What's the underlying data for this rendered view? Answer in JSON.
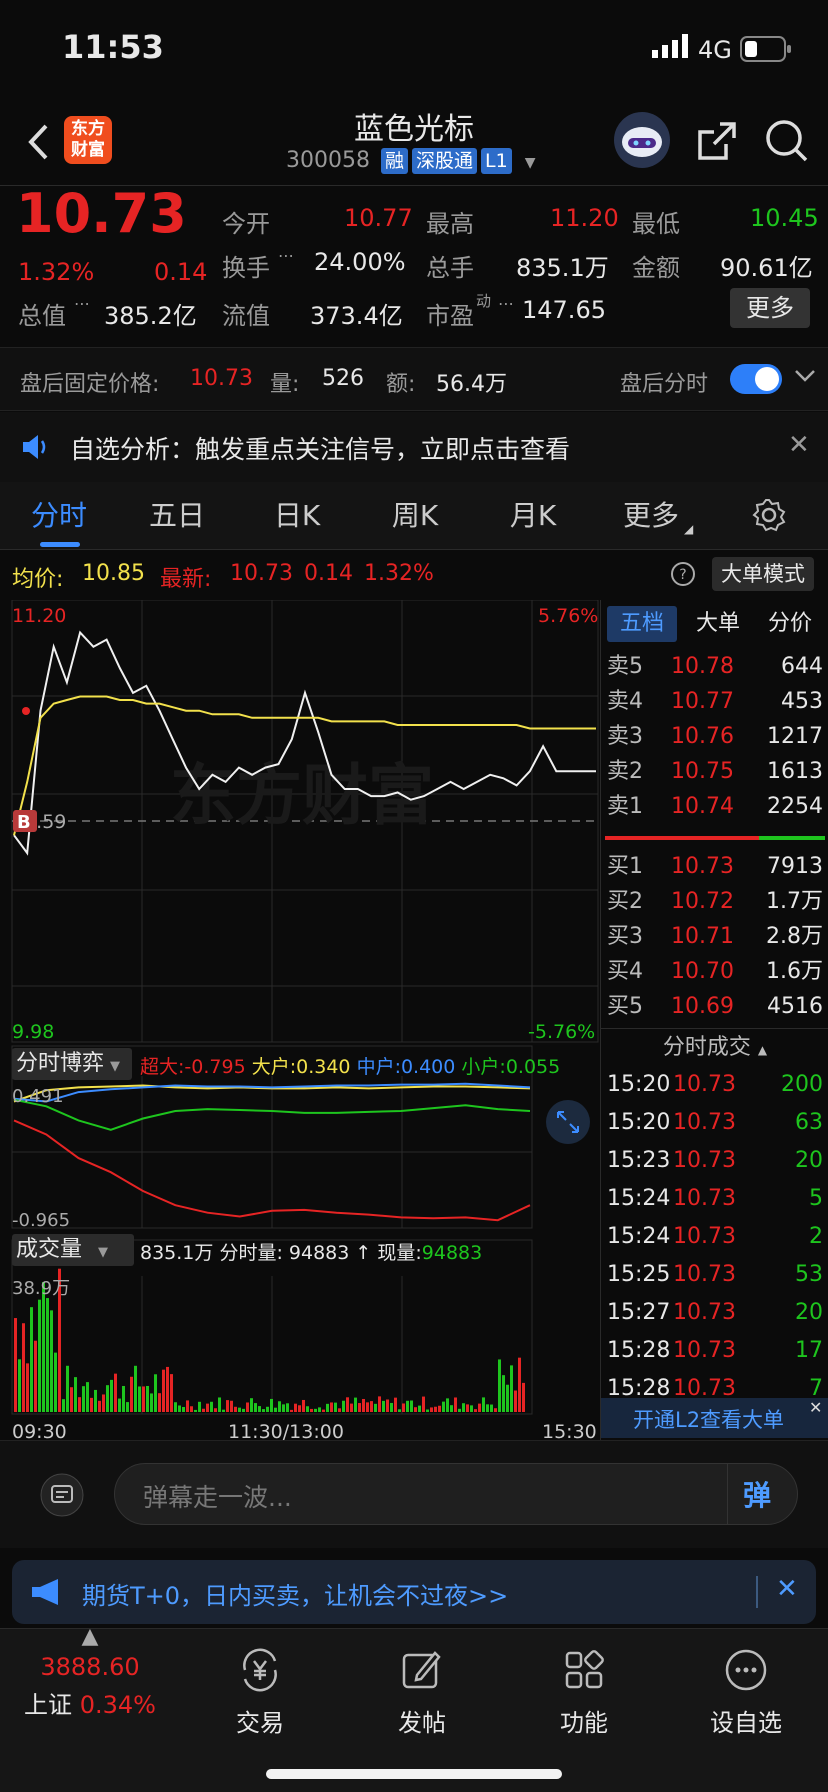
{
  "status_bar": {
    "time": "11:53",
    "network": "4G"
  },
  "header": {
    "app_logo_text": "东方财富",
    "title": "蓝色光标",
    "code": "300058",
    "badges": [
      "融",
      "深股通",
      "L1"
    ]
  },
  "quote": {
    "price": "10.73",
    "change_pct": "1.32%",
    "change": "0.14",
    "open_label": "今开",
    "open": "10.77",
    "high_label": "最高",
    "high": "11.20",
    "low_label": "最低",
    "low": "10.45",
    "turnover_label": "换手",
    "turnover": "24.00%",
    "volume_label": "总手",
    "volume": "835.1万",
    "amount_label": "金额",
    "amount": "90.61亿",
    "mcap_label": "总值",
    "mcap": "385.2亿",
    "float_label": "流值",
    "float_cap": "373.4亿",
    "pe_label": "市盈",
    "pe_sup": "动",
    "pe": "147.65",
    "more_button": "更多"
  },
  "after_hours": {
    "label": "盘后固定价格:",
    "price": "10.73",
    "qty_label": "量:",
    "qty": "526",
    "amt_label": "额:",
    "amt": "56.4万",
    "toggle_label": "盘后分时"
  },
  "notice": {
    "text": "自选分析：触发重点关注信号，立即点击查看"
  },
  "tabs": [
    "分时",
    "五日",
    "日K",
    "周K",
    "月K",
    "更多"
  ],
  "info_bar": {
    "avg_label": "均价:",
    "avg": "10.85",
    "latest_label": "最新:",
    "latest": "10.73",
    "latest_change": "0.14",
    "latest_pct": "1.32%",
    "mode_button": "大单模式"
  },
  "chart_labels": {
    "top_price": "11.20",
    "top_pct": "5.76%",
    "bottom_price": "9.98",
    "bottom_pct": "-5.76%",
    "mid_price": "10.59",
    "mark": "B",
    "watermark": "东方财富"
  },
  "chart_data": {
    "type": "line",
    "series": [
      {
        "values": [
          10.55,
          10.5,
          10.9,
          11.08,
          10.98,
          11.12,
          11.08,
          11.1,
          11.02,
          10.95,
          10.97,
          10.9,
          10.82,
          10.74,
          10.68,
          10.72,
          10.7,
          10.74,
          10.72,
          10.74,
          10.75,
          10.82,
          10.95,
          10.84,
          10.72,
          10.68,
          10.68,
          10.66,
          10.66,
          10.67,
          10.65,
          10.66,
          10.68,
          10.7,
          10.68,
          10.7,
          10.72,
          10.71,
          10.69,
          10.73,
          10.8,
          10.73,
          10.73,
          10.73,
          10.73
        ]
      },
      {
        "values": [
          10.55,
          10.7,
          10.88,
          10.92,
          10.93,
          10.94,
          10.94,
          10.94,
          10.93,
          10.93,
          10.92,
          10.92,
          10.91,
          10.9,
          10.9,
          10.89,
          10.89,
          10.89,
          10.88,
          10.88,
          10.88,
          10.88,
          10.88,
          10.88,
          10.87,
          10.87,
          10.87,
          10.87,
          10.87,
          10.86,
          10.86,
          10.86,
          10.86,
          10.86,
          10.86,
          10.86,
          10.86,
          10.86,
          10.86,
          10.85,
          10.85,
          10.85,
          10.85,
          10.85,
          10.85
        ]
      }
    ],
    "ylim": [
      9.98,
      11.2
    ],
    "x_ticks": [
      "09:30",
      "11:30/13:00",
      "15:30"
    ]
  },
  "game": {
    "selector": "分时博弈",
    "super_label": "超大:",
    "super": "-0.795",
    "big_label": "大户:",
    "big": "0.340",
    "mid_label": "中户:",
    "mid": "0.400",
    "small_label": "小户:",
    "small": "0.055",
    "top": "0.491",
    "bottom": "-0.965",
    "series": {
      "yellow": [
        0.3,
        0.42,
        0.45,
        0.46,
        0.47,
        0.45,
        0.44,
        0.45,
        0.44,
        0.44,
        0.45,
        0.44,
        0.45,
        0.46,
        0.46,
        0.45,
        0.44
      ],
      "blue": [
        0.33,
        0.3,
        0.4,
        0.43,
        0.45,
        0.47,
        0.46,
        0.46,
        0.45,
        0.46,
        0.47,
        0.47,
        0.48,
        0.48,
        0.49,
        0.47,
        0.45
      ],
      "green": [
        0.32,
        0.25,
        0.1,
        0.0,
        0.12,
        0.2,
        0.22,
        0.21,
        0.2,
        0.18,
        0.18,
        0.19,
        0.2,
        0.23,
        0.26,
        0.22,
        0.2
      ],
      "red": [
        0.1,
        -0.05,
        -0.3,
        -0.45,
        -0.65,
        -0.8,
        -0.88,
        -0.92,
        -0.86,
        -0.85,
        -0.88,
        -0.9,
        -0.93,
        -0.94,
        -0.93,
        -0.96,
        -0.8
      ]
    }
  },
  "volume": {
    "selector": "成交量",
    "total": "835.1万",
    "minute_label": "分时量:",
    "minute": "94883",
    "now_label": "现量:",
    "now": "94883",
    "top": "38.9万"
  },
  "panel_tabs": [
    "五档",
    "大单",
    "分价"
  ],
  "order_book": {
    "asks": [
      {
        "label": "卖5",
        "price": "10.78",
        "qty": "644"
      },
      {
        "label": "卖4",
        "price": "10.77",
        "qty": "453"
      },
      {
        "label": "卖3",
        "price": "10.76",
        "qty": "1217"
      },
      {
        "label": "卖2",
        "price": "10.75",
        "qty": "1613"
      },
      {
        "label": "卖1",
        "price": "10.74",
        "qty": "2254"
      }
    ],
    "bids": [
      {
        "label": "买1",
        "price": "10.73",
        "qty": "7913"
      },
      {
        "label": "买2",
        "price": "10.72",
        "qty": "1.7万"
      },
      {
        "label": "买3",
        "price": "10.71",
        "qty": "2.8万"
      },
      {
        "label": "买4",
        "price": "10.70",
        "qty": "1.6万"
      },
      {
        "label": "买5",
        "price": "10.69",
        "qty": "4516"
      }
    ]
  },
  "trades_title": "分时成交",
  "trades": [
    {
      "time": "15:20",
      "price": "10.73",
      "qty": "200"
    },
    {
      "time": "15:20",
      "price": "10.73",
      "qty": "63"
    },
    {
      "time": "15:23",
      "price": "10.73",
      "qty": "20"
    },
    {
      "time": "15:24",
      "price": "10.73",
      "qty": "5"
    },
    {
      "time": "15:24",
      "price": "10.73",
      "qty": "2"
    },
    {
      "time": "15:25",
      "price": "10.73",
      "qty": "53"
    },
    {
      "time": "15:27",
      "price": "10.73",
      "qty": "20"
    },
    {
      "time": "15:28",
      "price": "10.73",
      "qty": "17"
    },
    {
      "time": "15:28",
      "price": "10.73",
      "qty": "7"
    }
  ],
  "l2_banner": "开通L2查看大单",
  "bullet_input": {
    "placeholder": "弹幕走一波...",
    "send_label": "弹"
  },
  "promo": {
    "text": "期货T+0，日内买卖，让机会不过夜>>"
  },
  "tab_bar": {
    "index_value": "3888.60",
    "index_name": "上证",
    "index_pct": "0.34%",
    "items": [
      "交易",
      "发帖",
      "功能",
      "设自选"
    ]
  },
  "colors": {
    "up": "#e62424",
    "down": "#1ec51e",
    "accent": "#3c8cff",
    "avg_line": "#f2e14c"
  }
}
